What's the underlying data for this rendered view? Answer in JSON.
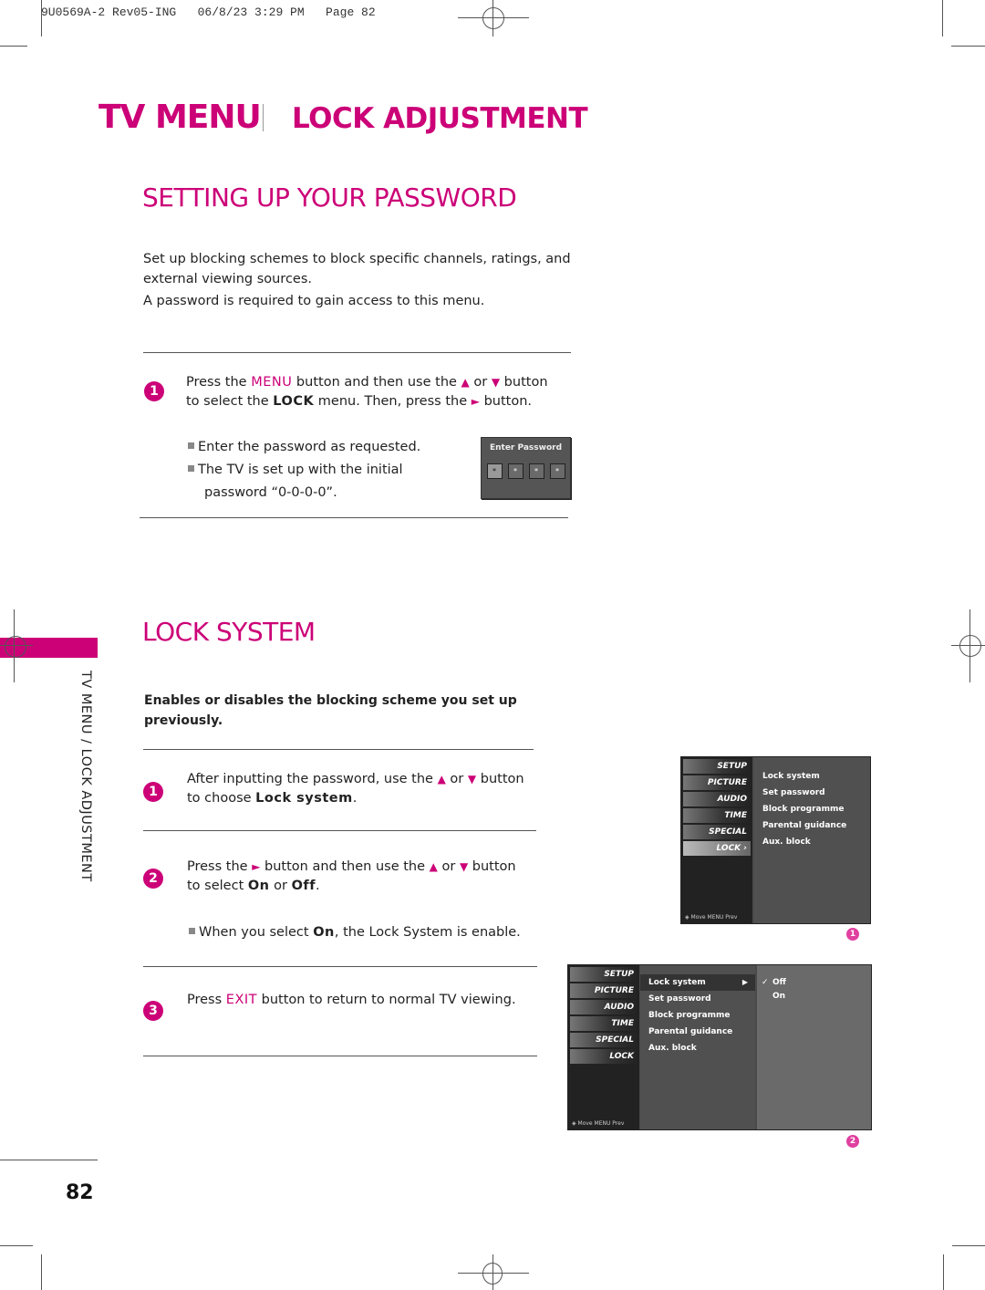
{
  "slug": "9U0569A-2 Rev05-ING   06/8/23 3:29 PM   Page 82",
  "header": {
    "title": "TV MENU",
    "subtitle": "LOCK ADJUSTMENT"
  },
  "side_tab": {
    "text": "TV MENU / LOCK ADJUSTMENT"
  },
  "colors": {
    "accent": "#cc0077",
    "text": "#222222",
    "tv_panel": "#4a4a4a"
  },
  "password_section": {
    "title": "SETTING UP YOUR PASSWORD",
    "intro_1": "Set up blocking schemes to block specific channels, ratings, and external viewing sources.",
    "intro_2": "A password is required to gain access to this menu.",
    "step1": {
      "num": "1",
      "t1": "Press the ",
      "kw_menu": "MENU",
      "t2": " button and then use the ",
      "up": "▲",
      "t3": " or ",
      "down": "▼",
      "t4": " button",
      "t5": "to select the ",
      "kw_lock": "LOCK",
      "t6": " menu. Then, press the ",
      "right": "►",
      "t7": " button."
    },
    "notes": [
      "Enter the password as requested.",
      "The TV is set up with the initial",
      "password “0-0-0-0”."
    ],
    "osd": {
      "label": "Enter Password",
      "cells": [
        "*",
        "*",
        "*",
        "*"
      ]
    }
  },
  "lock_section": {
    "title": "LOCK SYSTEM",
    "description": "Enables or disables the blocking scheme you set up previously.",
    "step1": {
      "num": "1",
      "t1": "After inputting the password, use the ",
      "up": "▲",
      "t2": " or ",
      "down": "▼",
      "t3": " button",
      "t4": "to choose ",
      "kw": "Lock system",
      "t5": "."
    },
    "step2": {
      "num": "2",
      "t1": "Press the ",
      "right": "►",
      "t2": " button and then use the ",
      "up": "▲",
      "t3": " or ",
      "down": "▼",
      "t4": " button",
      "t5": "to select ",
      "on": "On",
      "t6": " or ",
      "off": "Off",
      "t7": "."
    },
    "note": {
      "t1": "When you select ",
      "on": "On",
      "t2": ", the Lock System is enable."
    },
    "step3": {
      "num": "3",
      "t1": "Press ",
      "kw": "EXIT",
      "t2": " button to return to normal TV viewing."
    }
  },
  "tv_menu_1": {
    "fig": "1",
    "categories": [
      "SETUP",
      "PICTURE",
      "AUDIO",
      "TIME",
      "SPECIAL",
      "LOCK ›"
    ],
    "active_category": "LOCK",
    "items": [
      "Lock system",
      "Set password",
      "Block programme",
      "Parental guidance",
      "Aux. block"
    ],
    "footer": "◈ Move   MENU Prev"
  },
  "tv_menu_2": {
    "fig": "2",
    "categories": [
      "SETUP",
      "PICTURE",
      "AUDIO",
      "TIME",
      "SPECIAL",
      "LOCK"
    ],
    "items": [
      "Lock system",
      "Set password",
      "Block programme",
      "Parental guidance",
      "Aux. block"
    ],
    "selected_item": "Lock system",
    "item_arrow": "▶",
    "options": [
      {
        "label": "Off",
        "checked": "✓"
      },
      {
        "label": "On",
        "checked": ""
      }
    ],
    "footer": "◈ Move   MENU Prev"
  },
  "page_number": "82"
}
